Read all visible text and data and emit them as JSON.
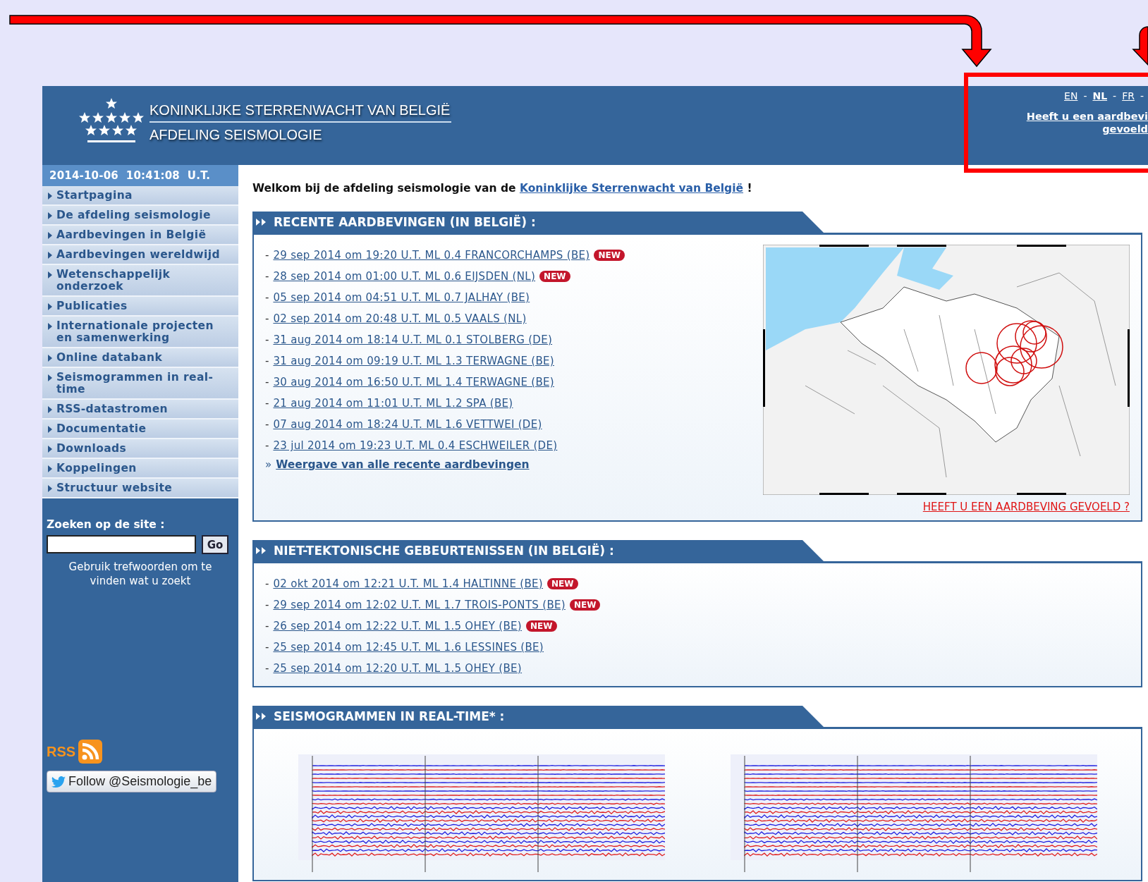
{
  "header": {
    "title": "KONINKLIJKE STERRENWACHT VAN BELGIË",
    "subtitle": "AFDELING SEISMOLOGIE",
    "languages": [
      {
        "label": "EN",
        "selected": false
      },
      {
        "label": "NL",
        "selected": true
      },
      {
        "label": "FR",
        "selected": false
      }
    ],
    "separator": "-",
    "felt_link": [
      "Heeft u een aardbevi",
      "gevoeld"
    ]
  },
  "sidebar": {
    "datetime": "2014-10-06  10:41:08  U.T.",
    "items": [
      "Startpagina",
      "De afdeling seismologie",
      "Aardbevingen in België",
      "Aardbevingen wereldwijd",
      "Wetenschappelijk onderzoek",
      "Publicaties",
      "Internationale projecten en samenwerking",
      "Online databank",
      "Seismogrammen in real-time",
      "RSS-datastromen",
      "Documentatie",
      "Downloads",
      "Koppelingen",
      "Structuur website"
    ],
    "search_label": "Zoeken op de site :",
    "search_button": "Go",
    "search_hint": "Gebruik trefwoorden om te vinden wat u zoekt",
    "rss_label": "RSS",
    "twitter_button": "Follow @Seismologie_be"
  },
  "welcome": {
    "text": "Welkom bij de afdeling seismologie van de",
    "link": "Koninklijke Sterrenwacht van België",
    "suffix": "!"
  },
  "sections": [
    {
      "kind": "quakes",
      "title": "RECENTE AARDBEVINGEN (IN BELGIË) :",
      "bullet": "-",
      "items": [
        {
          "text": "29 sep 2014 om 19:20 U.T. ML 0.4 FRANCORCHAMPS (BE)",
          "badge": "NEW"
        },
        {
          "text": "28 sep 2014 om 01:00 U.T. ML 0.6 EIJSDEN (NL)",
          "badge": "NEW"
        },
        {
          "text": "05 sep 2014 om 04:51 U.T. ML 0.7 JALHAY (BE)"
        },
        {
          "text": "02 sep 2014 om 20:48 U.T. ML 0.5 VAALS (NL)"
        },
        {
          "text": "31 aug 2014 om 18:14 U.T. ML 0.1 STOLBERG (DE)"
        },
        {
          "text": "31 aug 2014 om 09:19 U.T. ML 1.3 TERWAGNE (BE)"
        },
        {
          "text": "30 aug 2014 om 16:50 U.T. ML 1.4 TERWAGNE (BE)"
        },
        {
          "text": "21 aug 2014 om 11:01 U.T. ML 1.2 SPA (BE)"
        },
        {
          "text": "07 aug 2014 om 18:24 U.T. ML 1.6 VETTWEI (DE)"
        },
        {
          "text": "23 jul 2014 om 19:23 U.T. ML 0.4 ESCHWEILER (DE)"
        }
      ],
      "more_marker": "»",
      "more_link": "Weergave van alle recente aardbevingen",
      "map_caption": "HEEFT U EEN AARDBEVING GEVOELD ?"
    },
    {
      "kind": "events",
      "title": "NIET-TEKTONISCHE GEBEURTENISSEN (IN BELGIË) :",
      "bullet": "-",
      "items": [
        {
          "text": "02 okt 2014 om 12:21 U.T. ML 1.4 HALTINNE (BE)",
          "badge": "NEW"
        },
        {
          "text": "29 sep 2014 om 12:02 U.T. ML 1.7 TROIS-PONTS (BE)",
          "badge": "NEW"
        },
        {
          "text": "26 sep 2014 om 12:22 U.T. ML 1.5 OHEY (BE)",
          "badge": "NEW"
        },
        {
          "text": "25 sep 2014 om 12:45 U.T. ML 1.6 LESSINES (BE)"
        },
        {
          "text": "25 sep 2014 om 12:20 U.T. ML 1.5 OHEY (BE)"
        }
      ]
    },
    {
      "kind": "seismograms",
      "title": "SEISMOGRAMMEN IN REAL-TIME* :"
    }
  ]
}
